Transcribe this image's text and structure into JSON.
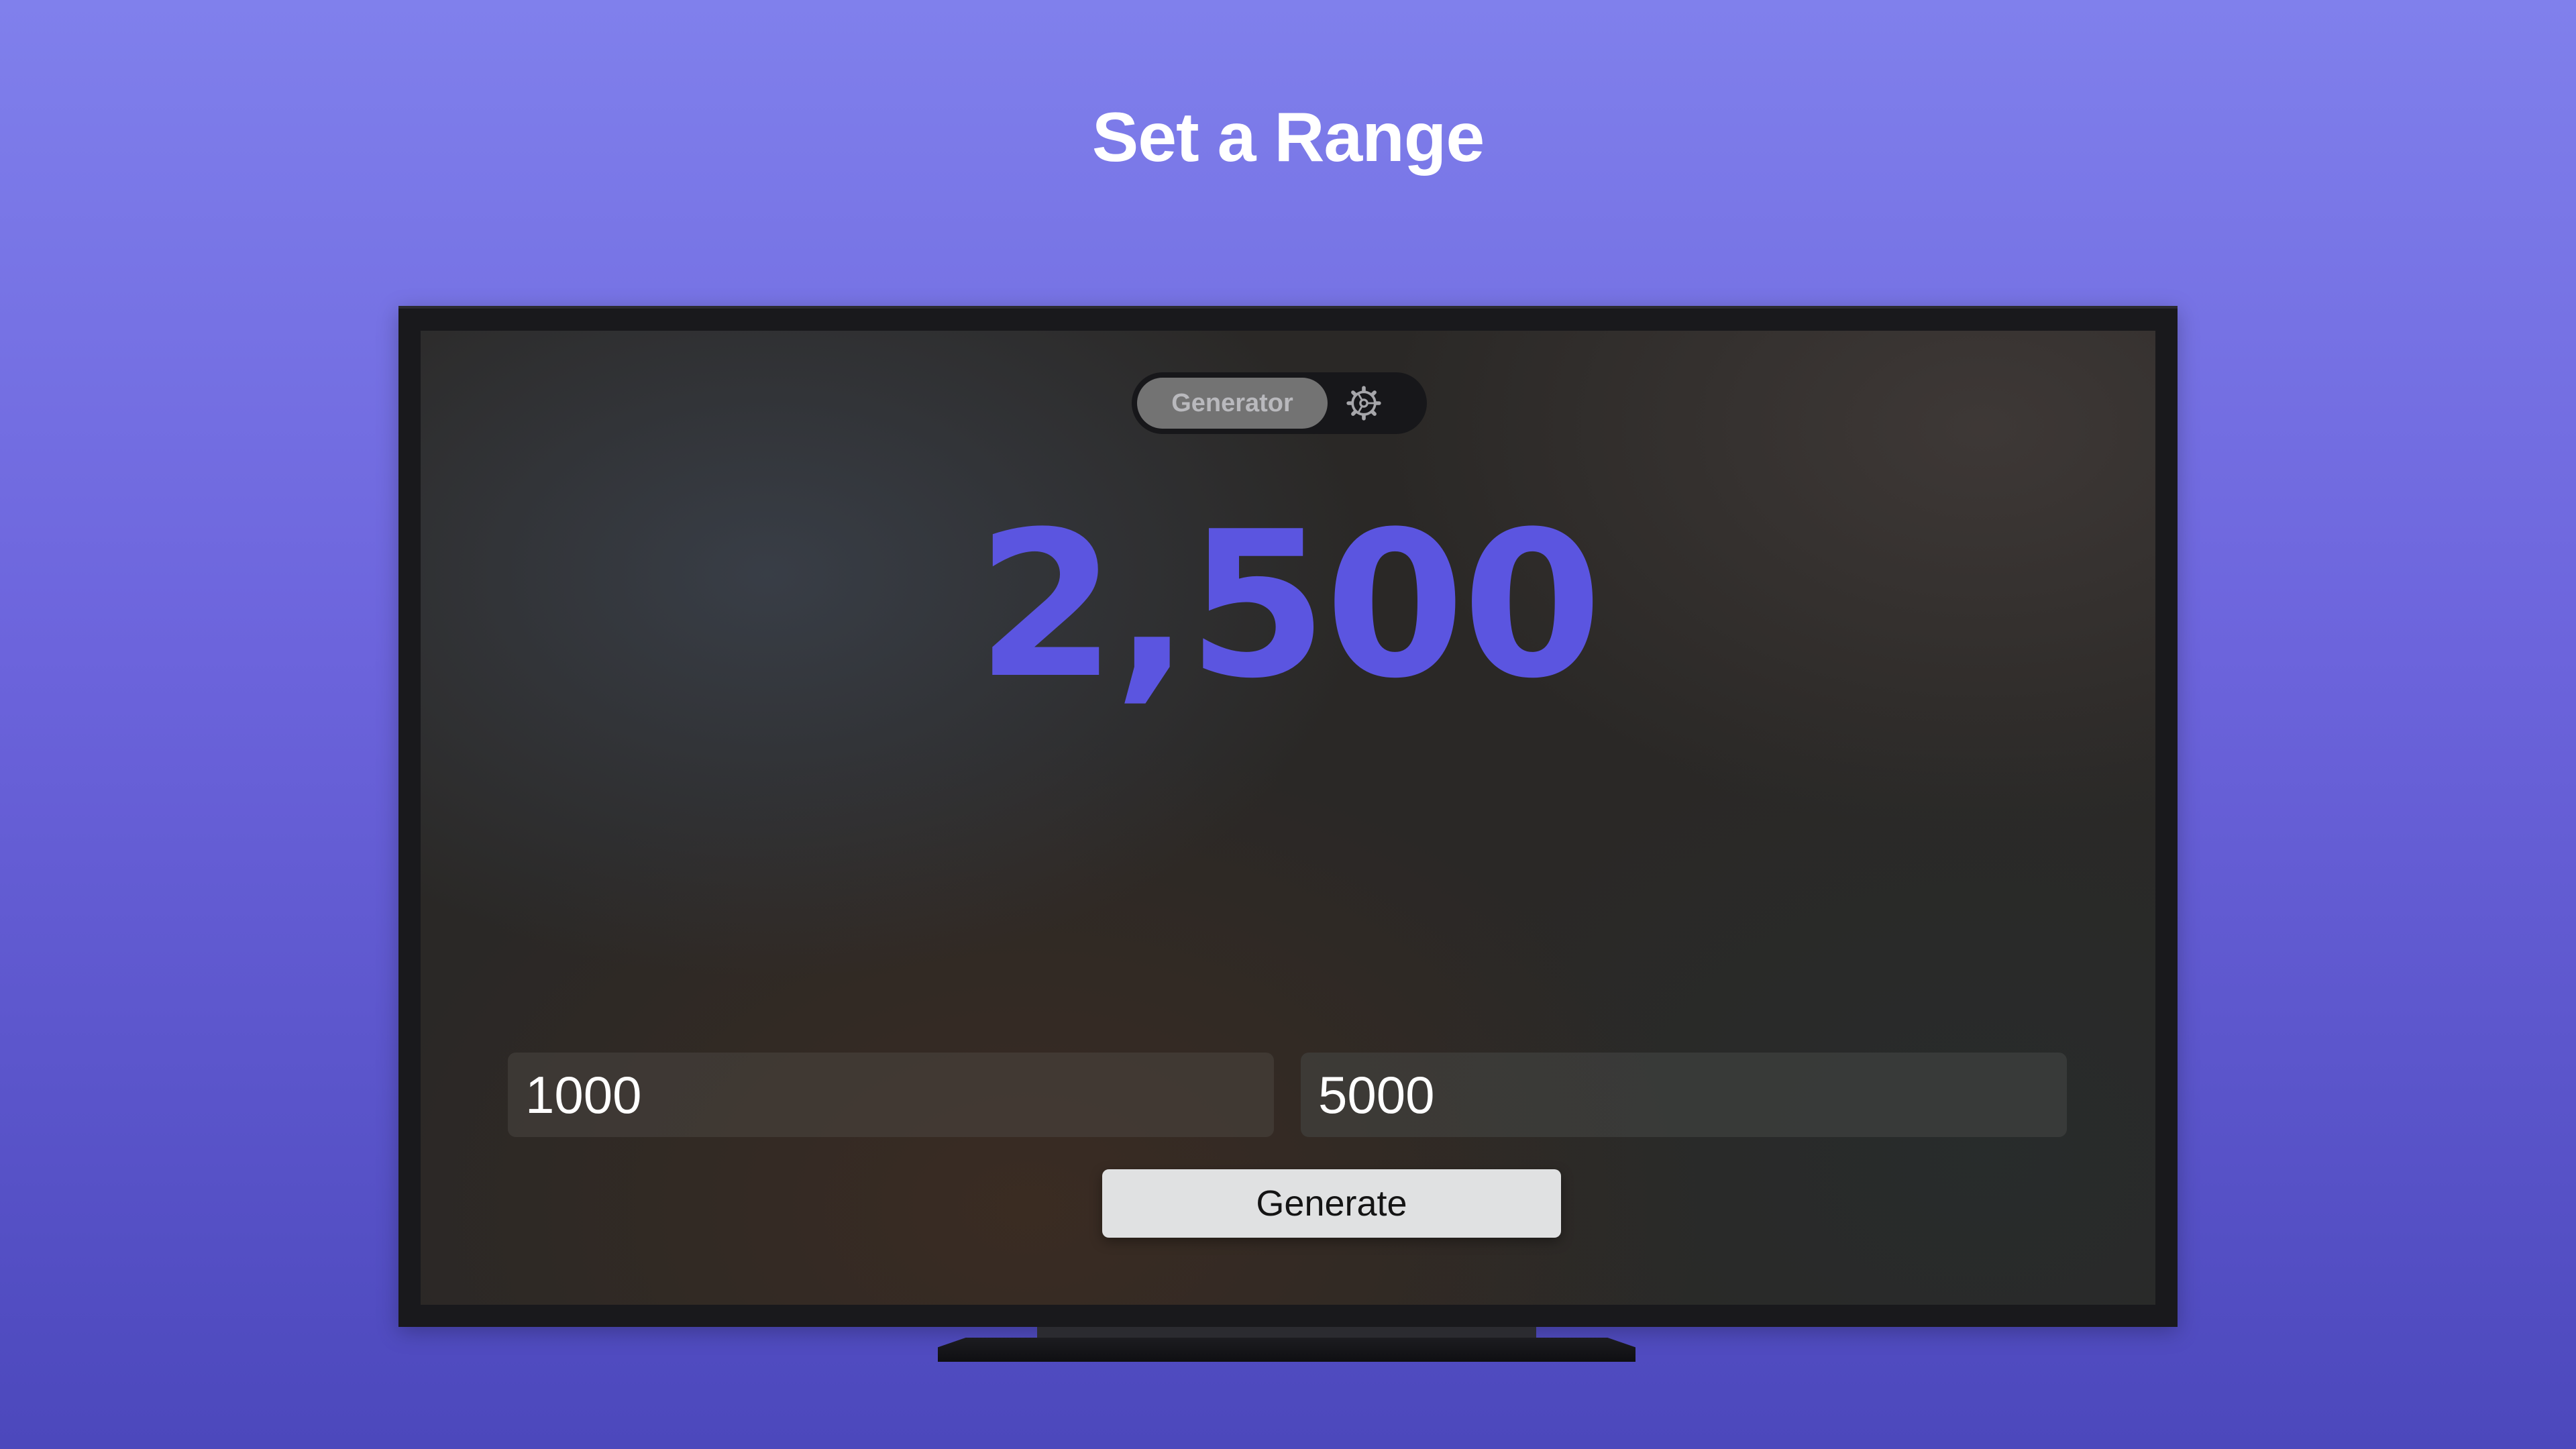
{
  "headline": "Set a Range",
  "app": {
    "tabs": {
      "generator_label": "Generator",
      "settings_icon": "gear-icon"
    },
    "result": {
      "value": "2,500",
      "color": "#5b55e0"
    },
    "range": {
      "min_value": "1000",
      "max_value": "5000"
    },
    "generate_label": "Generate"
  }
}
